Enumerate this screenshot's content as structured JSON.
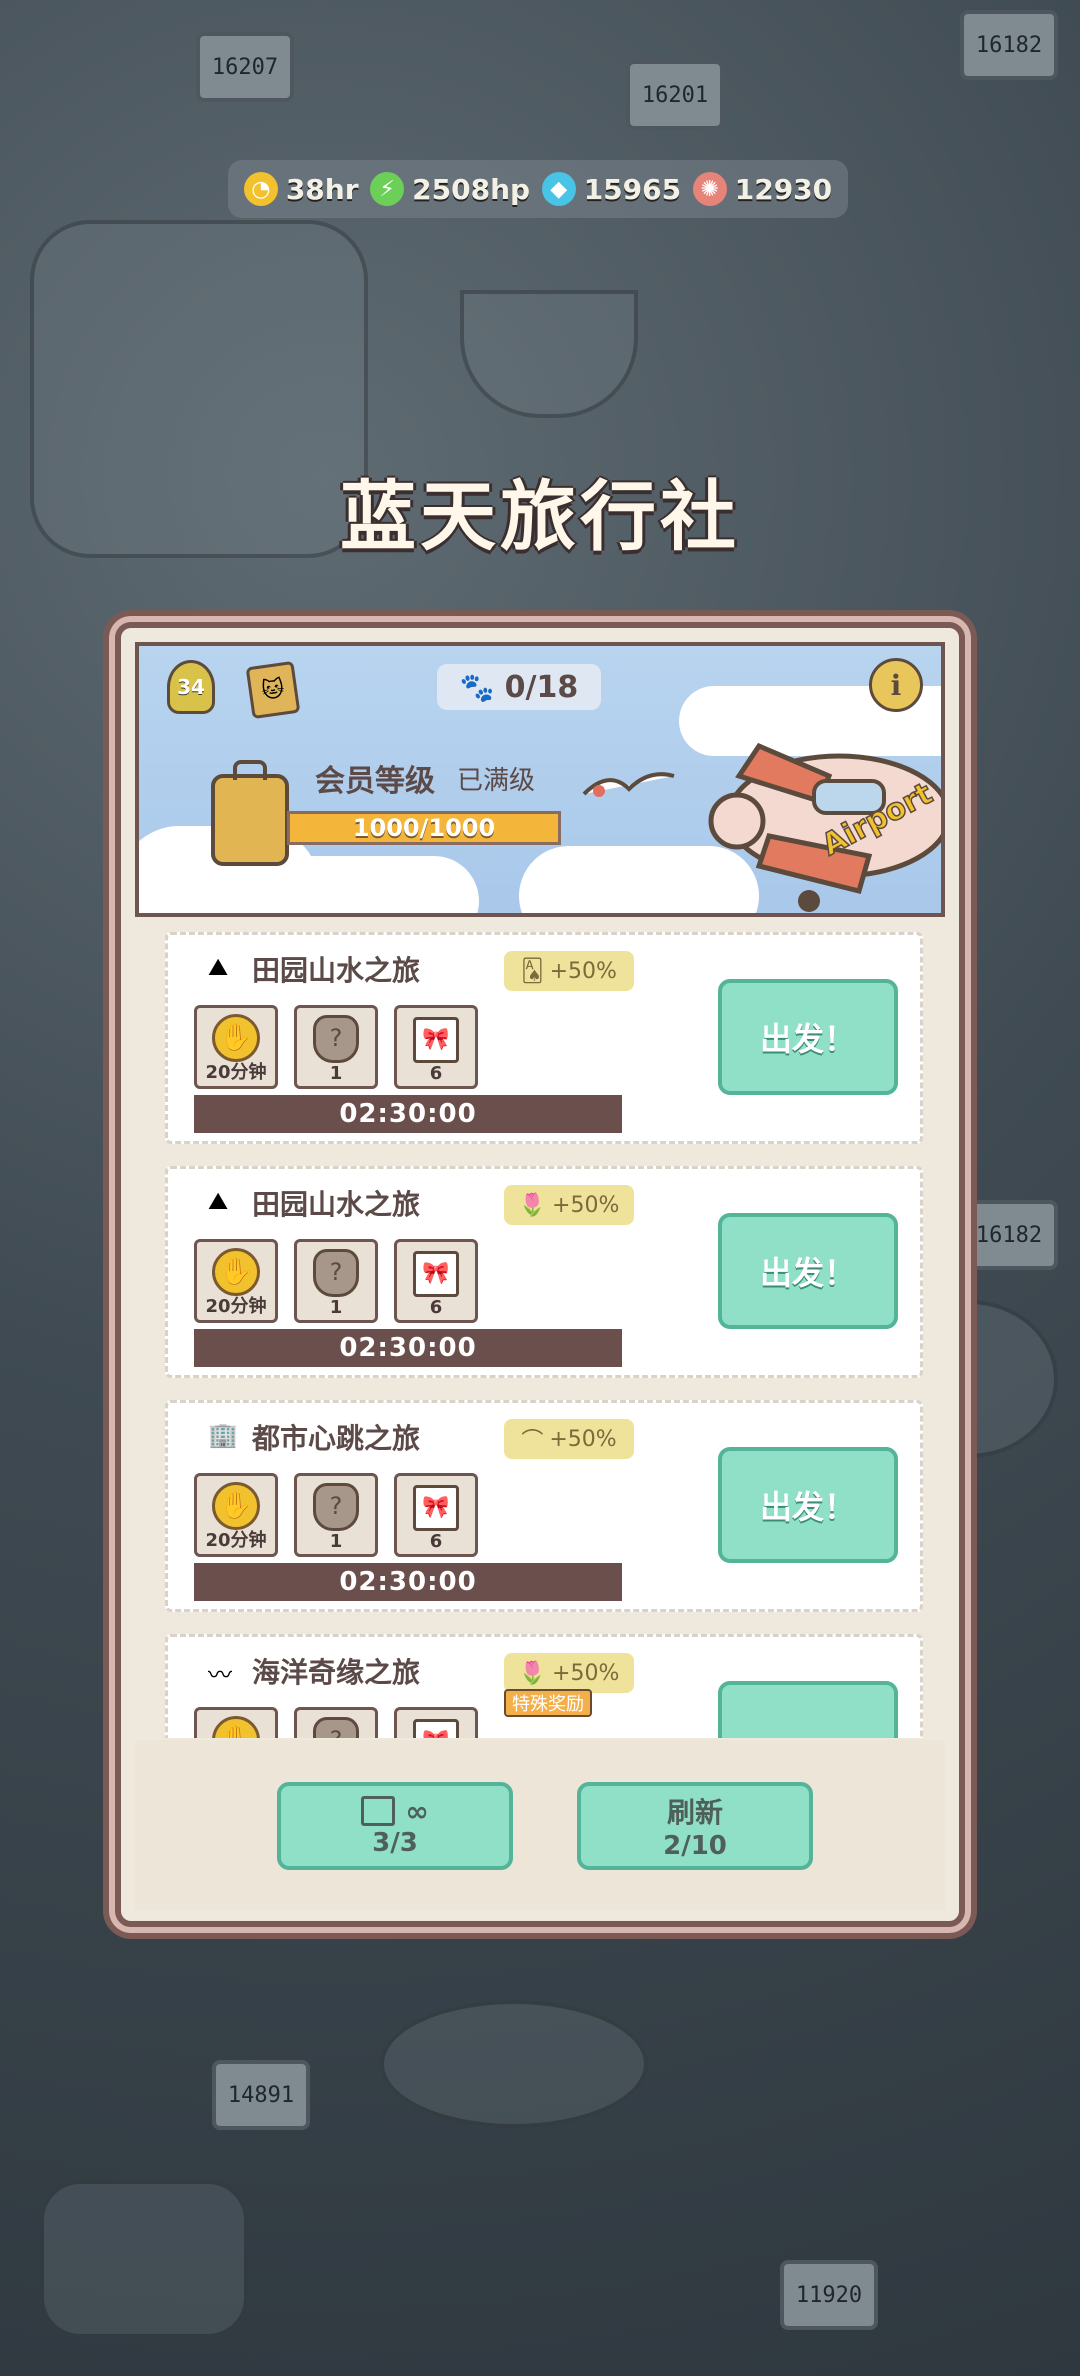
{
  "resources": [
    {
      "icon": "coin-clock-icon",
      "value": "38hr",
      "color": "#f2c12e"
    },
    {
      "icon": "lightning-icon",
      "value": "2508hp",
      "color": "#6ccf58"
    },
    {
      "icon": "diamond-icon",
      "value": "15965",
      "color": "#48c4e6"
    },
    {
      "icon": "shell-icon",
      "value": "12930",
      "color": "#e7847a"
    }
  ],
  "title": "蓝天旅行社",
  "banner": {
    "level": "34",
    "paw_progress": "0/18",
    "member_label": "会员等级",
    "member_status": "已满级",
    "progress_text": "1000/1000",
    "progress_fraction": 1.0,
    "plane_text": "Airport"
  },
  "trips": [
    {
      "name": "田园山水之旅",
      "icon": "mountain-icon",
      "bonus_icon": "cards-icon",
      "bonus": "+50%",
      "rewards": [
        {
          "kind": "coin",
          "qty": "20分钟"
        },
        {
          "kind": "acorn",
          "qty": "1"
        },
        {
          "kind": "gift",
          "qty": "6"
        }
      ],
      "timer": "02:30:00",
      "button": "出发！"
    },
    {
      "name": "田园山水之旅",
      "icon": "mountain-icon",
      "bonus_icon": "flower-pot-icon",
      "bonus": "+50%",
      "rewards": [
        {
          "kind": "coin",
          "qty": "20分钟"
        },
        {
          "kind": "acorn",
          "qty": "1"
        },
        {
          "kind": "gift",
          "qty": "6"
        }
      ],
      "timer": "02:30:00",
      "button": "出发！"
    },
    {
      "name": "都市心跳之旅",
      "icon": "building-icon",
      "bonus_icon": "fishing-rod-icon",
      "bonus": "+50%",
      "rewards": [
        {
          "kind": "coin",
          "qty": "20分钟"
        },
        {
          "kind": "acorn",
          "qty": "1"
        },
        {
          "kind": "gift",
          "qty": "6"
        }
      ],
      "timer": "02:30:00",
      "button": "出发！"
    },
    {
      "name": "海洋奇缘之旅",
      "icon": "wave-icon",
      "bonus_icon": "flower-pot-icon",
      "bonus": "+50%",
      "special": "特殊奖励",
      "rewards": [
        {
          "kind": "coin",
          "qty": ""
        },
        {
          "kind": "acorn",
          "qty": ""
        },
        {
          "kind": "gift",
          "qty": ""
        }
      ],
      "timer": "",
      "button": ""
    }
  ],
  "footer": {
    "ticket_symbol": "∞",
    "ticket_count": "3/3",
    "refresh_label": "刷新",
    "refresh_count": "2/10"
  }
}
